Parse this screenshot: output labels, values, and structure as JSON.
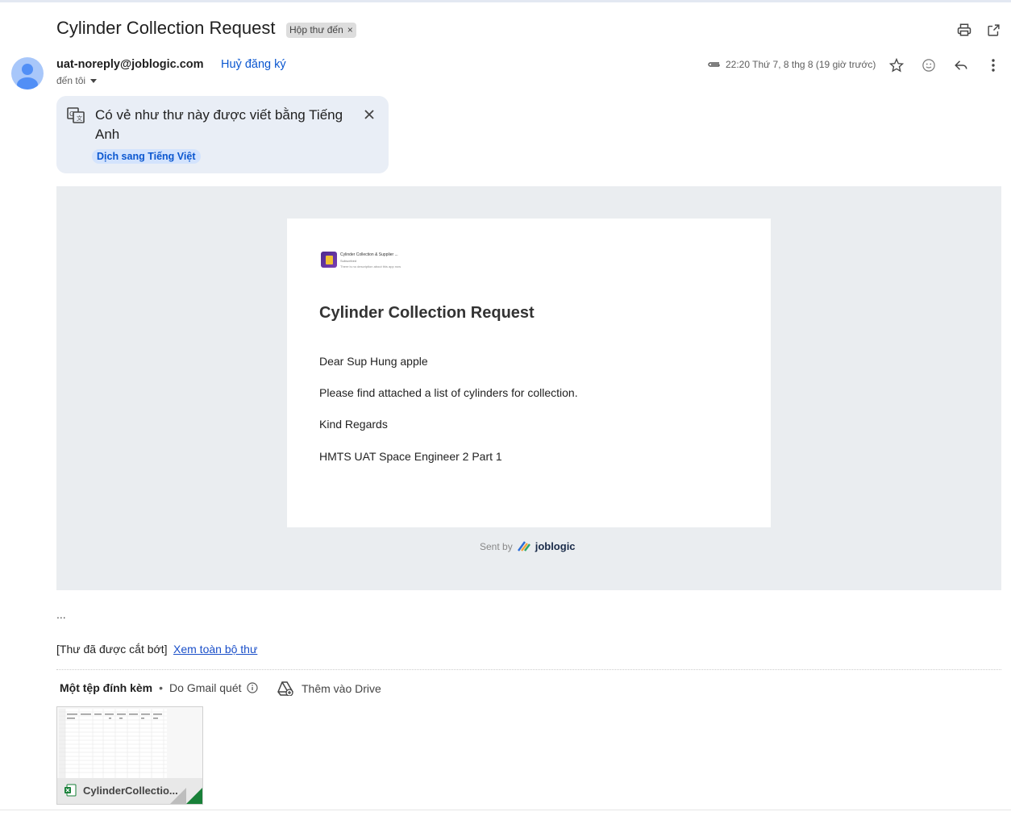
{
  "email": {
    "subject": "Cylinder Collection Request",
    "label_chip": "Hộp thư đến",
    "label_chip_close": "×",
    "sender": "uat-noreply@joblogic.com",
    "unsubscribe": "Huỷ đăng ký",
    "to_me": "đến tôi",
    "timestamp": "22:20 Thứ 7, 8 thg 8 (19 giờ trước)"
  },
  "icons": {
    "print": "print-icon",
    "open_new_window": "open-in-new-icon",
    "attachment": "paperclip-icon",
    "star": "star-icon",
    "emoji": "emoji-icon",
    "reply": "reply-icon",
    "more": "more-vert-icon",
    "translate": "translate-icon",
    "close": "close-icon",
    "drive": "drive-add-icon",
    "info": "info-icon",
    "excel": "excel-file-icon"
  },
  "translate_bar": {
    "message": "Có vẻ như thư này được viết bằng Tiếng Anh",
    "action": "Dịch sang Tiếng Việt"
  },
  "body": {
    "app_name": "Cylinder Collection & Supplier ...",
    "app_subtitle": "Subscribed",
    "app_description": "There is no description about this app now",
    "title": "Cylinder Collection Request",
    "greeting": "Dear Sup Hung apple",
    "line1": "Please find attached a list of cylinders for collection.",
    "closing": "Kind Regards",
    "signature": "HMTS UAT Space Engineer 2 Part 1",
    "sent_by": "Sent by",
    "brand": "joblogic"
  },
  "footer": {
    "ellipsis": "...",
    "clipped": "[Thư đã được cắt bớt]",
    "view_all": "Xem toàn bộ thư"
  },
  "attachments": {
    "heading": "Một tệp đính kèm",
    "scanned": "Do Gmail quét",
    "add_drive": "Thêm vào Drive",
    "file_name": "CylinderCollectio..."
  },
  "colors": {
    "link_blue": "#0b57d0",
    "translate_bg": "#e9eef6",
    "content_bg": "#eaedf0",
    "excel_green": "#188038"
  }
}
